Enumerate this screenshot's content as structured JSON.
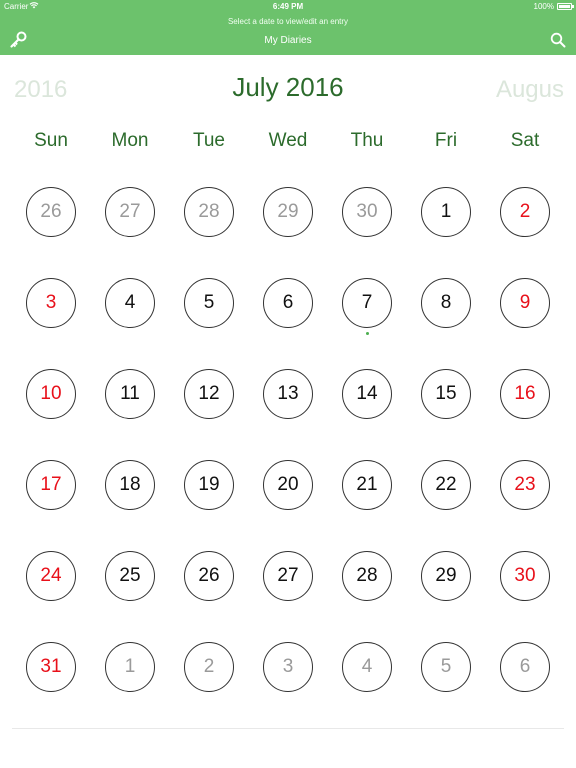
{
  "status_bar": {
    "carrier": "Carrier",
    "time": "6:49 PM",
    "battery": "100%"
  },
  "nav": {
    "hint": "Select a date to view/edit an entry",
    "title": "My Diaries",
    "left_icon": "key-icon",
    "right_icon": "search-icon",
    "bar_color": "#6cc26c"
  },
  "calendar": {
    "prev_label": "2016",
    "current_label": "July 2016",
    "next_label": "Augus",
    "weekdays": [
      "Sun",
      "Mon",
      "Tue",
      "Wed",
      "Thu",
      "Fri",
      "Sat"
    ],
    "weeks": [
      [
        {
          "d": "26",
          "t": "dim"
        },
        {
          "d": "27",
          "t": "dim"
        },
        {
          "d": "28",
          "t": "dim"
        },
        {
          "d": "29",
          "t": "dim"
        },
        {
          "d": "30",
          "t": "dim"
        },
        {
          "d": "1",
          "t": "weekday"
        },
        {
          "d": "2",
          "t": "weekend"
        }
      ],
      [
        {
          "d": "3",
          "t": "weekend"
        },
        {
          "d": "4",
          "t": "weekday"
        },
        {
          "d": "5",
          "t": "weekday"
        },
        {
          "d": "6",
          "t": "weekday"
        },
        {
          "d": "7",
          "t": "weekday",
          "entry": true
        },
        {
          "d": "8",
          "t": "weekday"
        },
        {
          "d": "9",
          "t": "weekend"
        }
      ],
      [
        {
          "d": "10",
          "t": "weekend"
        },
        {
          "d": "11",
          "t": "weekday"
        },
        {
          "d": "12",
          "t": "weekday"
        },
        {
          "d": "13",
          "t": "weekday"
        },
        {
          "d": "14",
          "t": "weekday"
        },
        {
          "d": "15",
          "t": "weekday"
        },
        {
          "d": "16",
          "t": "weekend"
        }
      ],
      [
        {
          "d": "17",
          "t": "weekend"
        },
        {
          "d": "18",
          "t": "weekday"
        },
        {
          "d": "19",
          "t": "weekday"
        },
        {
          "d": "20",
          "t": "weekday"
        },
        {
          "d": "21",
          "t": "weekday"
        },
        {
          "d": "22",
          "t": "weekday"
        },
        {
          "d": "23",
          "t": "weekend"
        }
      ],
      [
        {
          "d": "24",
          "t": "weekend"
        },
        {
          "d": "25",
          "t": "weekday"
        },
        {
          "d": "26",
          "t": "weekday"
        },
        {
          "d": "27",
          "t": "weekday"
        },
        {
          "d": "28",
          "t": "weekday"
        },
        {
          "d": "29",
          "t": "weekday"
        },
        {
          "d": "30",
          "t": "weekend"
        }
      ],
      [
        {
          "d": "31",
          "t": "weekend"
        },
        {
          "d": "1",
          "t": "dim"
        },
        {
          "d": "2",
          "t": "dim"
        },
        {
          "d": "3",
          "t": "dim"
        },
        {
          "d": "4",
          "t": "dim"
        },
        {
          "d": "5",
          "t": "dim"
        },
        {
          "d": "6",
          "t": "dim"
        }
      ]
    ],
    "colors": {
      "weekday": "#111111",
      "weekend": "#e8101a",
      "other_month": "#9a9a9a",
      "header": "#2c6b2c",
      "entry_dot": "#4caf50"
    }
  }
}
